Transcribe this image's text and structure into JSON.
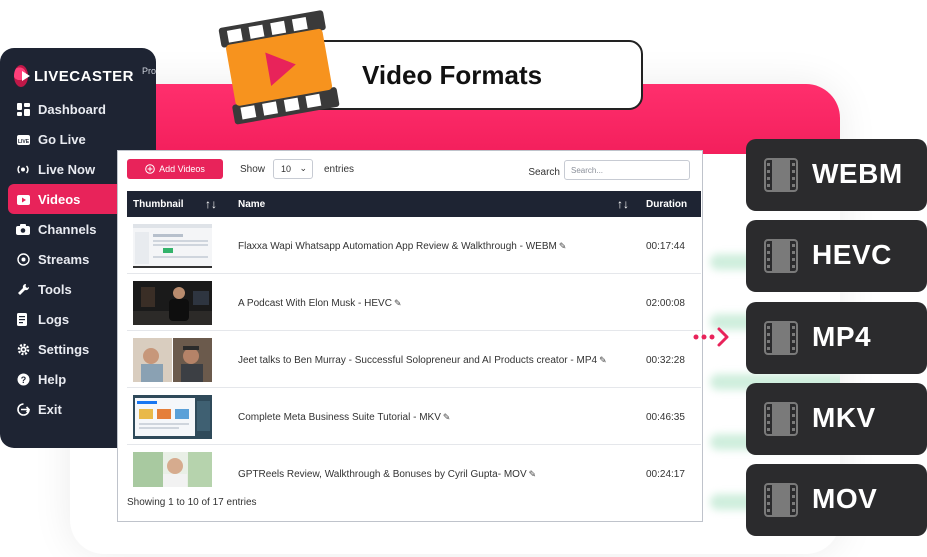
{
  "brand": {
    "name": "LIVECASTER",
    "suffix": "Pro"
  },
  "headline": "Video Formats",
  "sidebar": {
    "items": [
      {
        "label": "Dashboard",
        "icon": "dashboard-icon"
      },
      {
        "label": "Go Live",
        "icon": "go-live-icon"
      },
      {
        "label": "Live Now",
        "icon": "broadcast-icon"
      },
      {
        "label": "Videos",
        "icon": "video-icon",
        "active": true
      },
      {
        "label": "Channels",
        "icon": "camera-icon"
      },
      {
        "label": "Streams",
        "icon": "streams-icon"
      },
      {
        "label": "Tools",
        "icon": "tools-icon"
      },
      {
        "label": "Logs",
        "icon": "logs-icon"
      },
      {
        "label": "Settings",
        "icon": "gear-icon"
      },
      {
        "label": "Help",
        "icon": "help-icon"
      },
      {
        "label": "Exit",
        "icon": "exit-icon"
      }
    ]
  },
  "table": {
    "add_button": "Add Videos",
    "show_label": "Show",
    "page_size": "10",
    "entries_label": "entries",
    "search_label": "Search",
    "search_placeholder": "Search...",
    "columns": [
      "Thumbnail",
      "Name",
      "Duration"
    ],
    "rows": [
      {
        "name": "Flaxxa Wapi Whatsapp Automation App Review & Walkthrough - WEBM",
        "duration": "00:17:44"
      },
      {
        "name": "A Podcast With Elon Musk - HEVC",
        "duration": "02:00:08"
      },
      {
        "name": "Jeet talks to Ben Murray - Successful Solopreneur and AI Products creator - MP4",
        "duration": "00:32:28"
      },
      {
        "name": "Complete Meta Business Suite Tutorial - MKV",
        "duration": "00:46:35"
      },
      {
        "name": "GPTReels Review, Walkthrough & Bonuses by Cyril Gupta- MOV",
        "duration": "00:24:17"
      }
    ],
    "footer": "Showing 1 to 10 of 17 entries"
  },
  "formats": [
    "WEBM",
    "HEVC",
    "MP4",
    "MKV",
    "MOV"
  ],
  "colors": {
    "accent": "#e8235a",
    "sidebar": "#1e2433",
    "badge": "#2b2b2d",
    "film_orange": "#f7931e"
  }
}
